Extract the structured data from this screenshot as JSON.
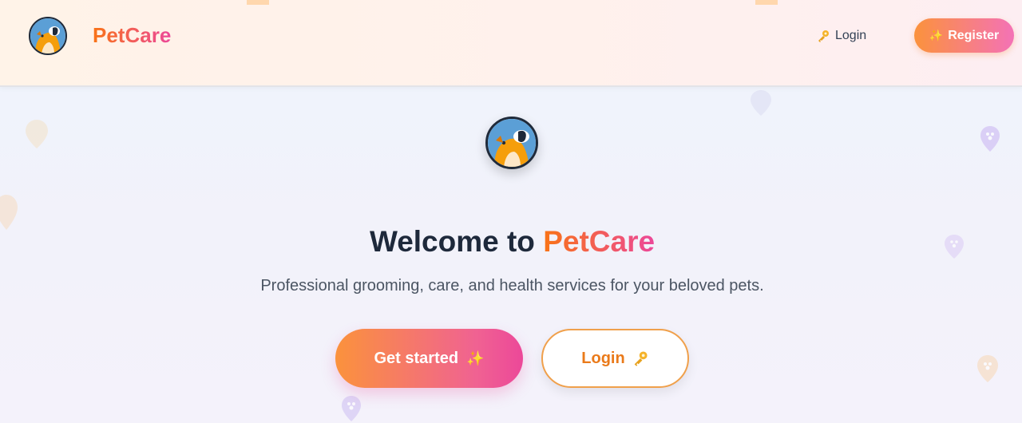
{
  "header": {
    "brand": "PetCare",
    "login_label": "Login",
    "register_label": "Register"
  },
  "hero": {
    "title_prefix": "Welcome to",
    "title_accent": "PetCare",
    "subtitle": "Professional grooming, care, and health services for your beloved pets.",
    "primary_cta": "Get started",
    "secondary_cta": "Login"
  },
  "icons": {
    "logo": "pet-logo-icon",
    "login": "key-icon",
    "register": "sparkles-icon",
    "get_started": "sparkles-icon",
    "secondary_login": "key-icon",
    "decor": "paw-pin-icon"
  },
  "colors": {
    "brand_orange": "#f97316",
    "brand_pink": "#ec4899",
    "logo_blue": "#5b9fd6",
    "text_dark": "#1e293b"
  }
}
